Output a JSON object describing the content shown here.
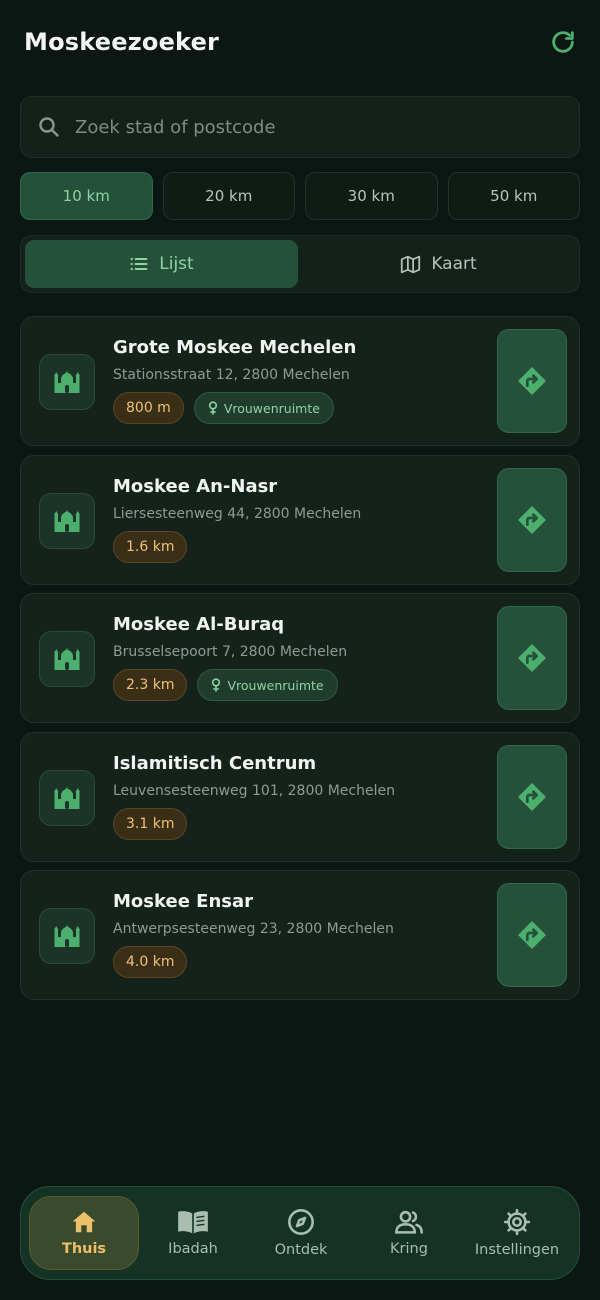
{
  "header": {
    "title": "Moskeezoeker",
    "refresh_icon": "refresh-icon"
  },
  "search": {
    "placeholder": "Zoek stad of postcode",
    "value": ""
  },
  "radius": {
    "options": [
      "10 km",
      "20 km",
      "30 km",
      "50 km"
    ],
    "selected": "10 km"
  },
  "view": {
    "list_label": "Lijst",
    "map_label": "Kaart",
    "selected": "Lijst"
  },
  "mosques": [
    {
      "name": "Grote Moskee Mechelen",
      "address": "Stationsstraat 12, 2800 Mechelen",
      "distance": "800 m",
      "women": "Vrouwenruimte"
    },
    {
      "name": "Moskee An-Nasr",
      "address": "Liersesteenweg 44, 2800 Mechelen",
      "distance": "1.6 km",
      "women": ""
    },
    {
      "name": "Moskee Al-Buraq",
      "address": "Brusselsepoort 7, 2800 Mechelen",
      "distance": "2.3 km",
      "women": "Vrouwenruimte"
    },
    {
      "name": "Islamitisch Centrum",
      "address": "Leuvensesteenweg 101, 2800 Mechelen",
      "distance": "3.1 km",
      "women": ""
    },
    {
      "name": "Moskee Ensar",
      "address": "Antwerpsesteenweg 23, 2800 Mechelen",
      "distance": "4.0 km",
      "women": ""
    }
  ],
  "nav": {
    "items": [
      {
        "label": "Thuis",
        "icon": "home-icon"
      },
      {
        "label": "Ibadah",
        "icon": "book-icon"
      },
      {
        "label": "Ontdek",
        "icon": "compass-icon"
      },
      {
        "label": "Kring",
        "icon": "people-icon"
      },
      {
        "label": "Instellingen",
        "icon": "gear-icon"
      }
    ],
    "active": "Thuis"
  },
  "colors": {
    "background": "#0c1612",
    "accent": "#4caf6e",
    "accent_dark": "#25503a",
    "distance_text": "#eec276",
    "nav_active": "#ecc06b"
  }
}
